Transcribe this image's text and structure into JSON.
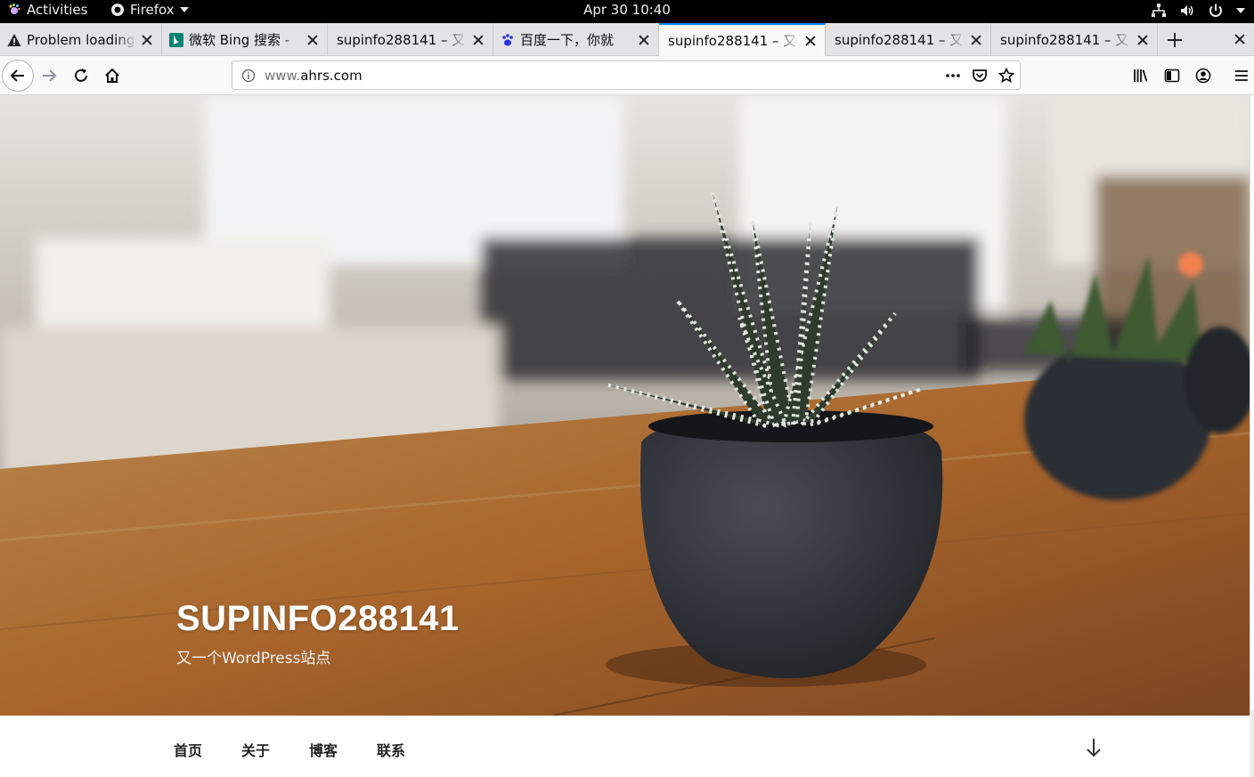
{
  "system_bar": {
    "activities": "Activities",
    "app_name": "Firefox",
    "clock": "Apr 30  10:40"
  },
  "tabs": [
    {
      "label": "Problem loading",
      "icon": "warning-icon",
      "active": false
    },
    {
      "label": "微软 Bing 搜索 -",
      "icon": "bing-icon",
      "active": false
    },
    {
      "label": "supinfo288141 – 又",
      "icon": "none",
      "active": false
    },
    {
      "label": "百度一下，你就",
      "icon": "baidu-paw-icon",
      "active": false
    },
    {
      "label": "supinfo288141 – 又",
      "icon": "none",
      "active": true
    },
    {
      "label": "supinfo288141 – 又",
      "icon": "none",
      "active": false
    },
    {
      "label": "supinfo288141 – 又",
      "icon": "none",
      "active": false
    }
  ],
  "navbar": {
    "url_prefix": "www.",
    "url_domain": "ahrs.com"
  },
  "site": {
    "title": "SUPINFO288141",
    "description": "又一个WordPress站点"
  },
  "menu": {
    "items": [
      "首页",
      "关于",
      "博客",
      "联系"
    ]
  },
  "colors": {
    "active_tab_accent": "#0a84ff",
    "topbar": "#000000"
  }
}
